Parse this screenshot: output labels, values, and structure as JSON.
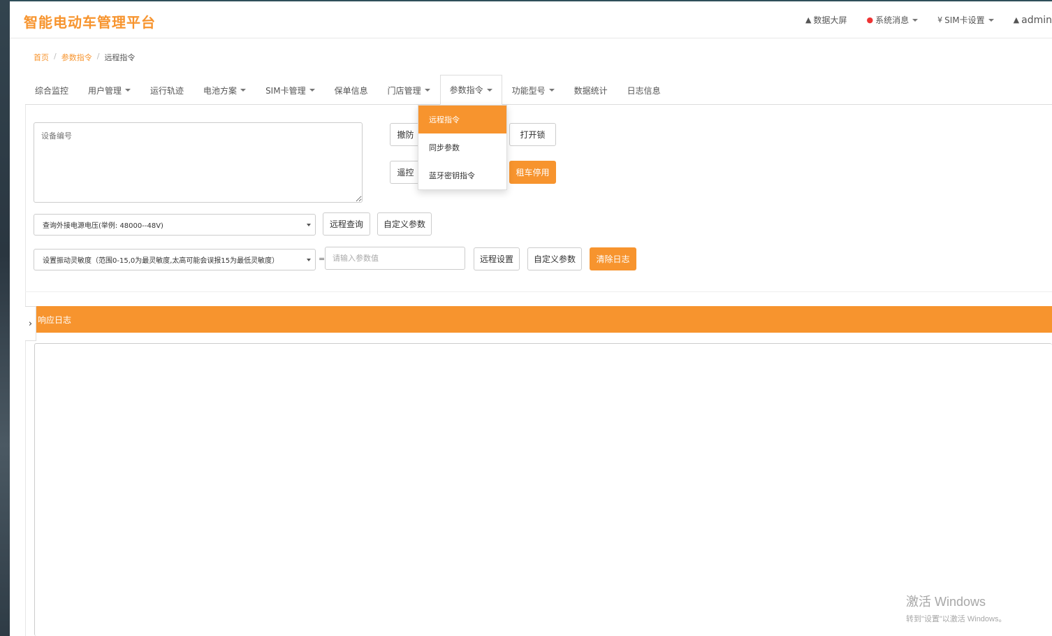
{
  "app": {
    "title": "智能电动车管理平台"
  },
  "header_nav": {
    "data_screen": "数据大屏",
    "system_messages": "系统消息",
    "sim_settings": "SIM卡设置",
    "user": "admin"
  },
  "breadcrumb": {
    "home": "首页",
    "params": "参数指令",
    "current": "远程指令"
  },
  "tabs": [
    "综合监控",
    "用户管理",
    "运行轨迹",
    "电池方案",
    "SIM卡管理",
    "保单信息",
    "门店管理",
    "参数指令",
    "功能型号",
    "数据统计",
    "日志信息"
  ],
  "dropdown": {
    "items": [
      "远程指令",
      "同步参数",
      "蓝牙密钥指令"
    ]
  },
  "form": {
    "device_placeholder": "设备编号",
    "btn_row1_a": "撤防",
    "btn_row1_b": "打开锁",
    "btn_row2_a": "遥控",
    "btn_row2_b": "租车停用",
    "query_select": "查询外接电源电压(举例: 48000--48V)",
    "btn_remote_query": "远程查询",
    "btn_custom_params_1": "自定义参数",
    "set_select": "设置振动灵敏度（范围0-15,0为最灵敏度,太高可能会误报15为最低灵敏度）",
    "eq_sign": "=",
    "param_placeholder": "请输入参数值",
    "btn_remote_set": "远程设置",
    "btn_custom_params_2": "自定义参数",
    "btn_clear_log": "清除日志"
  },
  "log": {
    "title": "响应日志",
    "toggle": "›"
  },
  "watermark": {
    "title": "激活 Windows",
    "sub": "转到\"设置\"以激活 Windows。"
  }
}
